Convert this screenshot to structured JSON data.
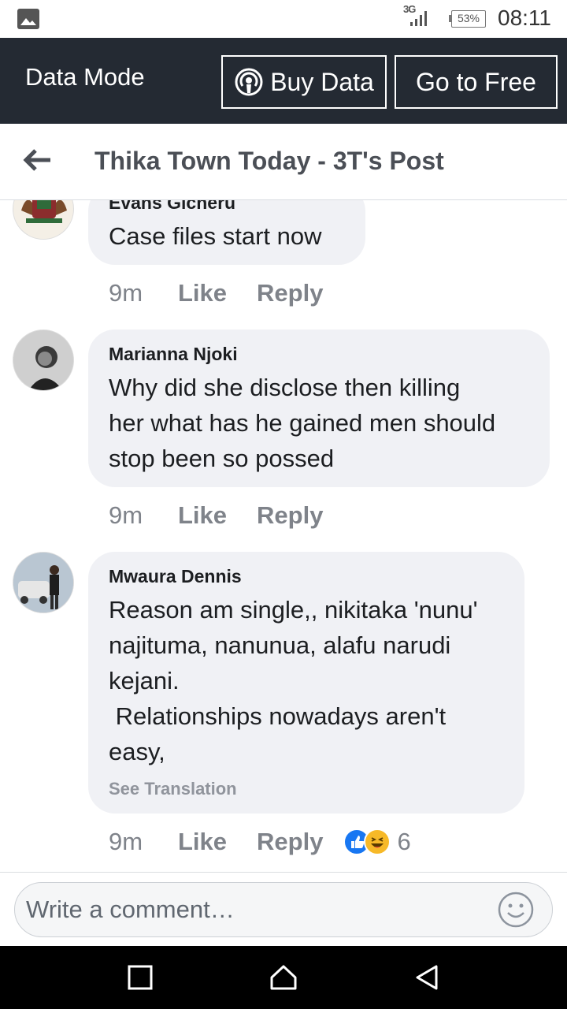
{
  "status_bar": {
    "network": "3G",
    "battery": "53%",
    "time": "08:11"
  },
  "data_bar": {
    "title": "Data Mode",
    "buy_data": "Buy Data",
    "go_to_free": "Go to Free"
  },
  "header": {
    "title": "Thika Town Today - 3T's Post"
  },
  "comments": [
    {
      "author": "Evans Gicheru",
      "text": "Case files start now",
      "time": "9m",
      "like": "Like",
      "reply": "Reply"
    },
    {
      "author": "Marianna Njoki",
      "text": "Why did she disclose then killing\nher what has he gained men should\nstop been so possed",
      "time": "9m",
      "like": "Like",
      "reply": "Reply"
    },
    {
      "author": "Mwaura Dennis",
      "text": "Reason am single,, nikitaka 'nunu'\nnajituma, nanunua, alafu narudi\nkejani.\n Relationships nowadays aren't\neasy,",
      "see_translation": "See Translation",
      "time": "9m",
      "like": "Like",
      "reply": "Reply",
      "reaction_icons": [
        "like-reaction",
        "haha-reaction"
      ],
      "reaction_count": "6"
    }
  ],
  "composer": {
    "placeholder": "Write a comment…"
  },
  "colors": {
    "data_bar_bg": "#242a33",
    "bubble_bg": "#f0f1f5",
    "like_blue": "#1877f2",
    "haha_yellow": "#f7b928"
  }
}
